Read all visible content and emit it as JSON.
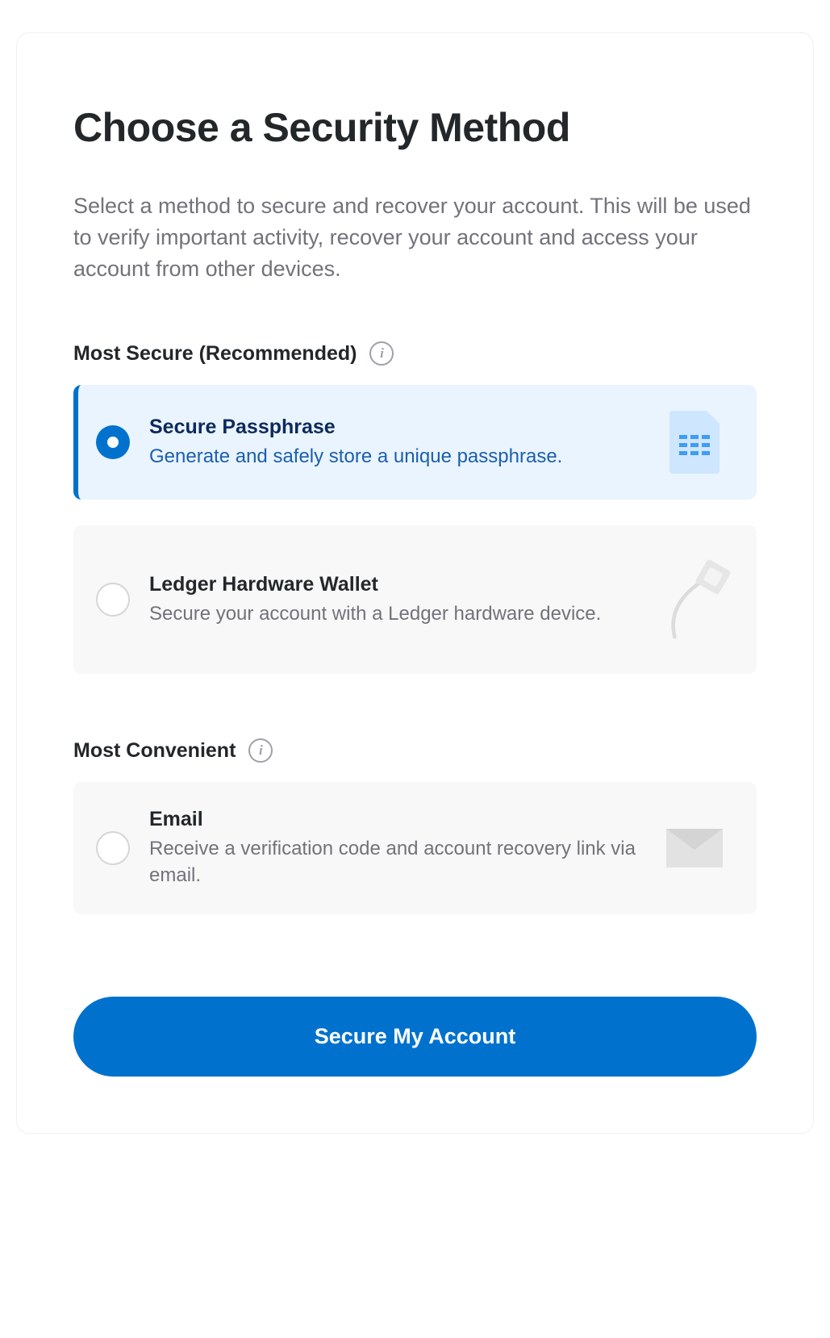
{
  "header": {
    "title": "Choose a Security Method",
    "description": "Select a method to secure and recover your account. This will be used to verify important activity, recover your account and access your account from other devices."
  },
  "sections": {
    "secure": {
      "label": "Most Secure (Recommended)"
    },
    "convenient": {
      "label": "Most Convenient"
    }
  },
  "options": {
    "passphrase": {
      "title": "Secure Passphrase",
      "description": "Generate and safely store a unique passphrase.",
      "selected": true
    },
    "ledger": {
      "title": "Ledger Hardware Wallet",
      "description": "Secure your account with a Ledger hardware device.",
      "selected": false
    },
    "email": {
      "title": "Email",
      "description": "Receive a verification code and account recovery link via email.",
      "selected": false
    }
  },
  "actions": {
    "primary_label": "Secure My Account"
  }
}
